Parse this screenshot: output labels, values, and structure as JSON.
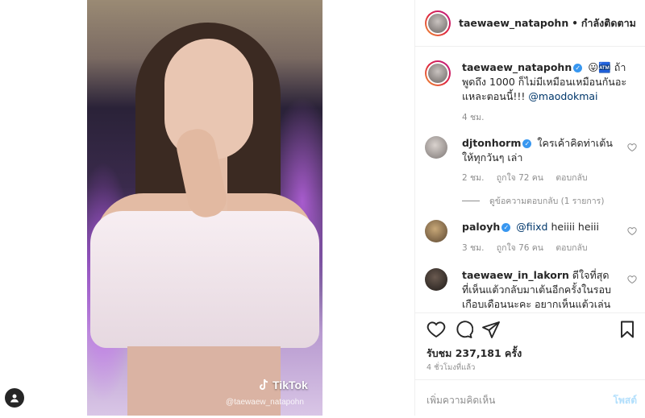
{
  "video": {
    "watermark_logo": "TikTok",
    "watermark_handle": "@taewaew_natapohn"
  },
  "header": {
    "username": "taewaew_natapohn",
    "separator": "•",
    "follow_status": "กำลังติดตาม"
  },
  "caption": {
    "username": "taewaew_natapohn",
    "text_before": "😛🏧 ถ้าพูดถึง 1000 ก็ไม่มีเหมือนเหมือนกันอะแหละตอนนี้!!! ",
    "mention": "@maodokmai",
    "time": "4 ชม."
  },
  "comments": [
    {
      "username": "djtonhorm",
      "verified": true,
      "text": "ใครเค้าคิดท่าเต้นให้ทุกวันๆ เล่า",
      "time": "2 ชม.",
      "likes": "ถูกใจ 72 คน",
      "reply": "ตอบกลับ",
      "view_replies": "ดูข้อความตอบกลับ (1 รายการ)"
    },
    {
      "username": "paloyh",
      "verified": true,
      "mention": "@fiixd",
      "text": " heiiii heiii",
      "time": "3 ชม.",
      "likes": "ถูกใจ 76 คน",
      "reply": "ตอบกลับ"
    },
    {
      "username": "taewaew_in_lakorn",
      "verified": false,
      "text": "ดีใจที่สุดที่เห็นแต้วกลับมาเต้นอีกครั้งในรอบเกือบเดือนนะคะ อยากเห็นแต้วเล่นเปียโนอีก"
    }
  ],
  "actions": {
    "likes_label": "รับชม 237,181 ครั้ง",
    "time_ago": "4 ชั่วโมงที่แล้ว",
    "add_comment_placeholder": "เพิ่มความคิดเห็น",
    "post_label": "โพสต์"
  },
  "colors": {
    "verified": "#3897f0",
    "mention": "#00376b",
    "muted": "#8e8e8e",
    "post_disabled": "#b2dffc"
  },
  "icons": [
    "heart-icon",
    "comment-icon",
    "share-icon",
    "bookmark-icon",
    "user-icon",
    "tiktok-icon"
  ]
}
